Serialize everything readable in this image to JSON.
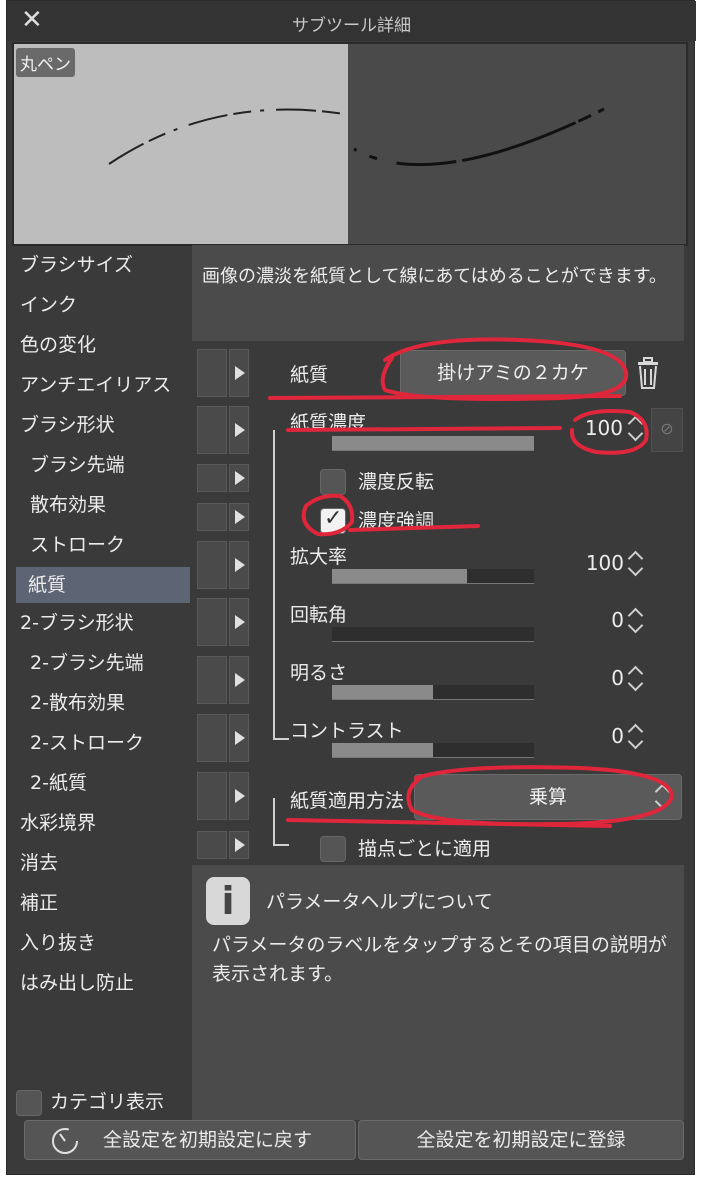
{
  "window": {
    "title": "サブツール詳細",
    "close_glyph": "✕"
  },
  "preview": {
    "tool_name": "丸ペン"
  },
  "sidebar": {
    "items": [
      {
        "label": "ブラシサイズ"
      },
      {
        "label": "インク"
      },
      {
        "label": "色の変化"
      },
      {
        "label": "アンチエイリアス"
      },
      {
        "label": "ブラシ形状"
      },
      {
        "label": "ブラシ先端"
      },
      {
        "label": "散布効果"
      },
      {
        "label": "ストローク"
      },
      {
        "label": "紙質"
      },
      {
        "label": "2-ブラシ形状"
      },
      {
        "label": "2-ブラシ先端"
      },
      {
        "label": "2-散布効果"
      },
      {
        "label": "2-ストローク"
      },
      {
        "label": "2-紙質"
      },
      {
        "label": "水彩境界"
      },
      {
        "label": "消去"
      },
      {
        "label": "補正"
      },
      {
        "label": "入り抜き"
      },
      {
        "label": "はみ出し防止"
      }
    ],
    "selected": "紙質",
    "category_toggle_label": "カテゴリ表示"
  },
  "description": "画像の濃淡を紙質として線にあてはめることができます。",
  "params": {
    "texture": {
      "label": "紙質",
      "value": "掛けアミの２カケ"
    },
    "texture_density": {
      "label": "紙質濃度",
      "value": "100",
      "level": 1.0
    },
    "invert_density": {
      "label": "濃度反転",
      "checked": false
    },
    "emphasize_density": {
      "label": "濃度強調",
      "checked": true,
      "check_glyph": "✓"
    },
    "scale": {
      "label": "拡大率",
      "value": "100",
      "level": 0.67
    },
    "rotation": {
      "label": "回転角",
      "value": "0",
      "level": 0.0
    },
    "brightness": {
      "label": "明るさ",
      "value": "0",
      "level": 0.5
    },
    "contrast": {
      "label": "コントラスト",
      "value": "0",
      "level": 0.5
    },
    "apply_method": {
      "label": "紙質適用方法",
      "value": "乗算"
    },
    "apply_per_dot": {
      "label": "描点ごとに適用",
      "checked": false
    }
  },
  "help": {
    "icon_glyph": "i",
    "heading": "パラメータヘルプについて",
    "body": "パラメータのラベルをタップするとその項目の説明が表示されます。"
  },
  "footer": {
    "reset_label": "全設定を初期設定に戻す",
    "register_label": "全設定を初期設定に登録"
  },
  "colors": {
    "annotation": "#e0263a",
    "selected": "#5d6575",
    "panel": "#3a3a3a"
  }
}
